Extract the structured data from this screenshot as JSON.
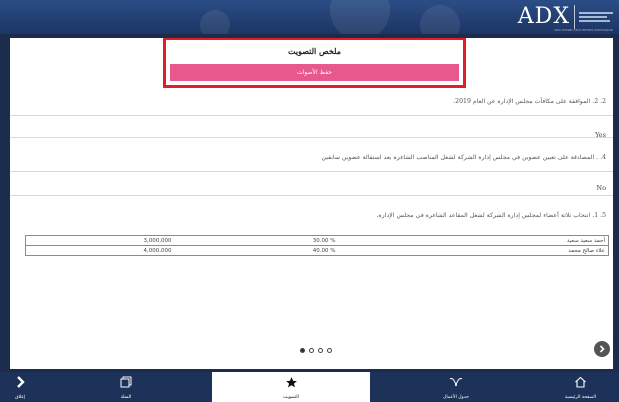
{
  "header": {
    "logo_text": "ADX",
    "logo_subtext": "ABU DHABI SECURITIES EXCHANGE"
  },
  "summary": {
    "title": "ملخص التصويت",
    "save_button_label": "حفظ الأصوات"
  },
  "items": [
    {
      "question": "2. 2. الموافقة على مكافآت مجلس الإدارة عن العام 2019.",
      "answer": "Yes"
    },
    {
      "question": "4. . المصادقة على تعيين عضوين في مجلس إدارة الشركة لشغل المناصب الشاغرة بعد استقالة عضوين سابقين",
      "answer": "No"
    },
    {
      "question": "5. 1. انتخاب ثلاثة أعضاء لمجلس إدارة الشركة لشغل المقاعد الشاغرة في مجلس الإدارة."
    }
  ],
  "results": [
    {
      "name": "أحمد سعيد سعيد",
      "percent": "30.00 %",
      "votes": "3,000,000"
    },
    {
      "name": "علاء صالح محمد",
      "percent": "40.00 %",
      "votes": "4,000,000"
    }
  ],
  "pagination": {
    "pages": 4,
    "current": 1
  },
  "tabbar": {
    "back_label": "إغلاق",
    "basket_label": "السلة",
    "vote_label": "التصويت",
    "agenda_label": "جدول الأعمال",
    "home_label": "الصفحة الرئيسية"
  },
  "colors": {
    "header_blue": "#1c3564",
    "accent_pink": "#e8588a",
    "highlight_red": "#e41e26",
    "tabbar_blue": "#1d3258"
  }
}
